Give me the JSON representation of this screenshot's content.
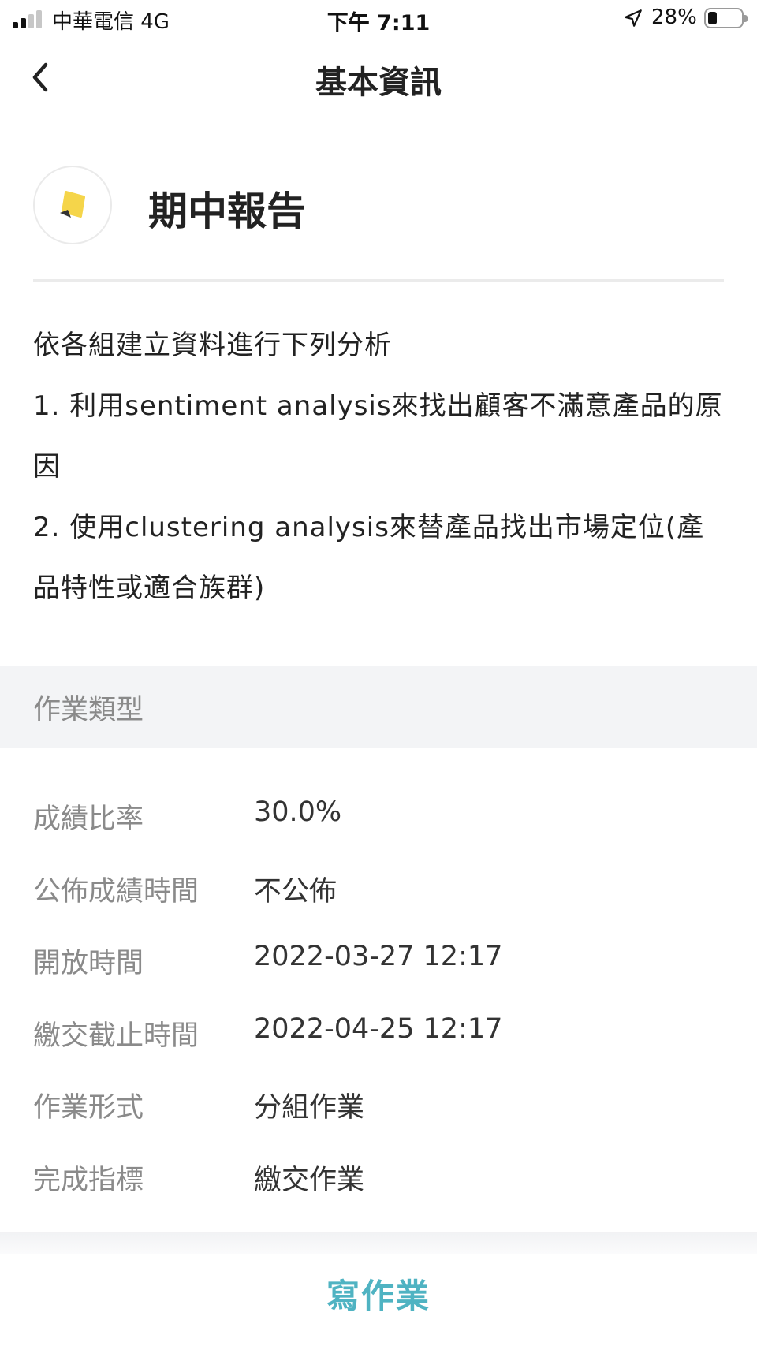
{
  "status_bar": {
    "carrier": "中華電信  4G",
    "time": "下午 7:11",
    "battery_percent": "28%",
    "battery_level": 0.28,
    "signal_bars_filled": 2,
    "signal_bars_total": 4
  },
  "nav": {
    "title": "基本資訊",
    "back_icon": "chevron-left-icon"
  },
  "assignment": {
    "icon": "note-icon",
    "icon_color": "#f5d54a",
    "title": "期中報告"
  },
  "description": {
    "lines": [
      "依各組建立資料進行下列分析",
      "1. 利用sentiment analysis來找出顧客不滿意產品的原因",
      "2. 使用clustering analysis來替產品找出市場定位(產品特性或適合族群)"
    ]
  },
  "section": {
    "title": "作業類型"
  },
  "info": {
    "rows": [
      {
        "label": "成績比率",
        "value": "30.0%"
      },
      {
        "label": "公佈成績時間",
        "value": "不公佈"
      },
      {
        "label": "開放時間",
        "value": "2022-03-27 12:17"
      },
      {
        "label": "繳交截止時間",
        "value": "2022-04-25 12:17"
      },
      {
        "label": "作業形式",
        "value": "分組作業"
      },
      {
        "label": "完成指標",
        "value": "繳交作業"
      }
    ]
  },
  "bottom": {
    "write_button": "寫作業",
    "accent_color": "#4fb3c2"
  }
}
